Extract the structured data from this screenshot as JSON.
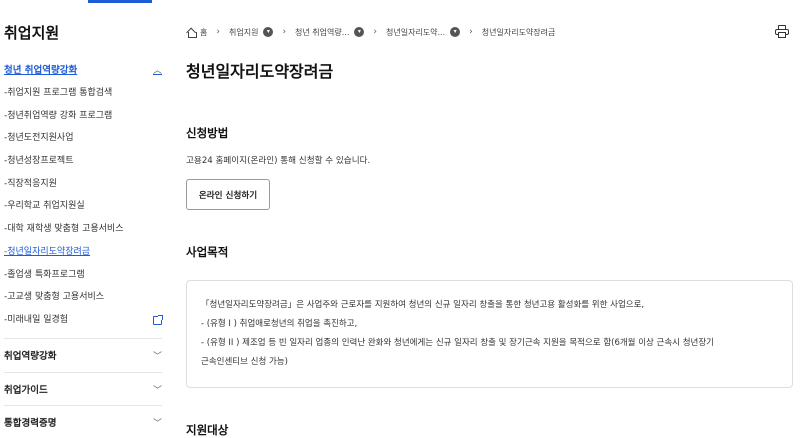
{
  "sidebar": {
    "title": "취업지원",
    "active_section": "청년 취업역량강화",
    "items": [
      {
        "label": "-취업지원 프로그램 통합검색"
      },
      {
        "label": "-청년취업역량 강화 프로그램"
      },
      {
        "label": "-청년도전지원사업"
      },
      {
        "label": "-청년성장프로젝트"
      },
      {
        "label": "-직장적응지원"
      },
      {
        "label": "-우리학교 취업지원실"
      },
      {
        "label": "-대학 재학생 맞춤형 고용서비스"
      },
      {
        "label": "-청년일자리도약장려금"
      },
      {
        "label": "-졸업생 특화프로그램"
      },
      {
        "label": "-고교생 맞춤형 고용서비스"
      },
      {
        "label": "-미래내일 일경험"
      }
    ],
    "sections": [
      {
        "label": "취업역량강화"
      },
      {
        "label": "취업가이드"
      },
      {
        "label": "통합경력증명"
      }
    ]
  },
  "breadcrumb": {
    "home": "홈",
    "items": [
      "취업지원",
      "청년 취업역량...",
      "청년일자리도약...",
      "청년일자리도약장려금"
    ]
  },
  "main": {
    "title": "청년일자리도약장려금",
    "apply": {
      "title": "신청방법",
      "text": "고용24 홈페이지(온라인) 통해 신청할 수 있습니다.",
      "button": "온라인 신청하기"
    },
    "purpose": {
      "title": "사업목적",
      "lines": [
        "「청년일자리도약장려금」은 사업주와 근로자를 지원하여 청년의 신규 일자리 창출을 통한 청년고용 활성화를 위한 사업으로,",
        "- (유형 I ) 취업애로청년의 취업을 촉진하고,",
        "- (유형 II ) 제조업 등 빈 일자리 업종의 인력난 완화와 청년에게는 신규 일자리 창출 및 장기근속 지원을 목적으로 함(6개월 이상 근속시 청년장기",
        "근속인센티브 신청 가능)"
      ]
    },
    "target": {
      "title": "지원대상"
    }
  },
  "colors": {
    "accent": "#1e5bd6"
  }
}
